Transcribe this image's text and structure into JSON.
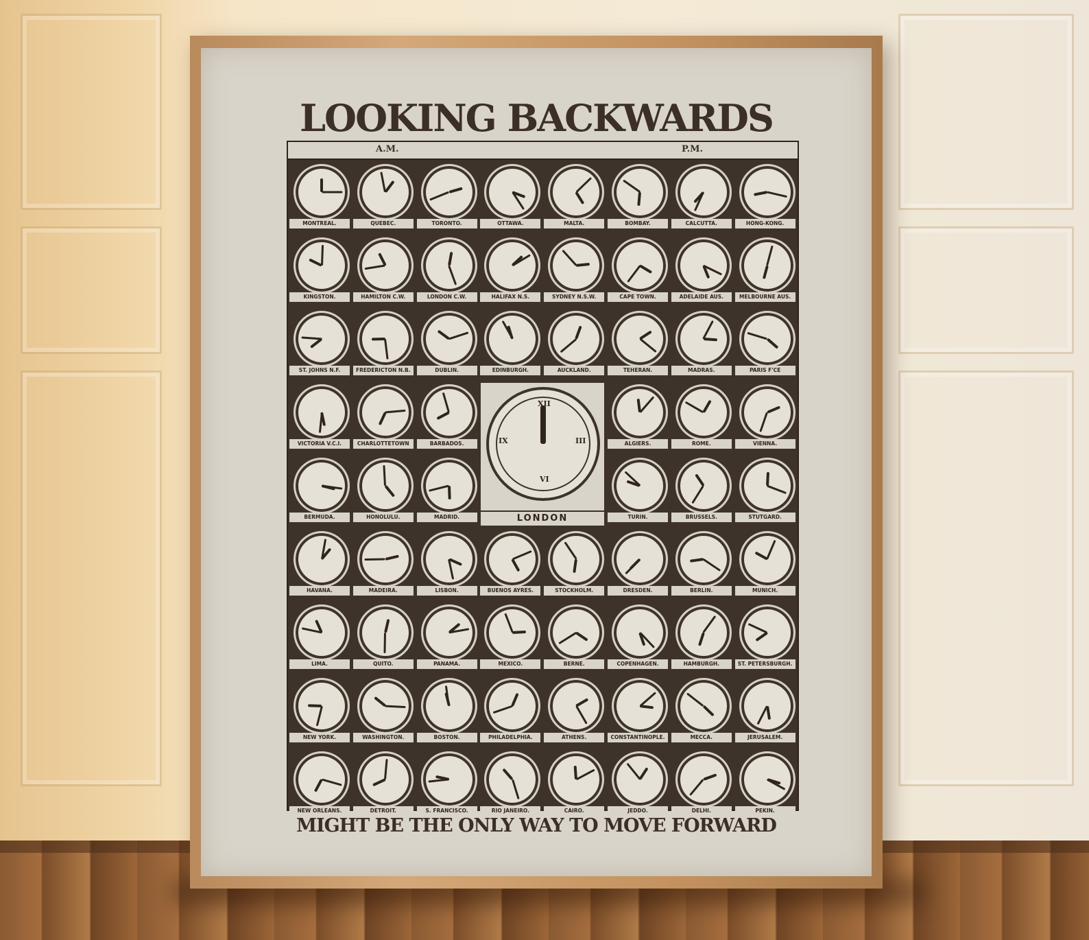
{
  "poster": {
    "title": "LOOKING BACKWARDS",
    "subtitle": "MIGHT BE THE ONLY WAY TO MOVE FORWARD",
    "am_label": "A.M.",
    "pm_label": "P.M.",
    "center_city": "LONDON"
  },
  "rows": [
    [
      "MONTREAL.",
      "QUEBEC.",
      "TORONTO.",
      "OTTAWA.",
      "MALTA.",
      "BOMBAY.",
      "CALCUTTA.",
      "HONG-KONG."
    ],
    [
      "KINGSTON.",
      "HAMILTON C.W.",
      "LONDON C.W.",
      "HALIFAX N.S.",
      "SYDNEY N.S.W.",
      "CAPE TOWN.",
      "ADELAIDE AUS.",
      "MELBOURNE AUS."
    ],
    [
      "ST. JOHNS N.F.",
      "FREDERICTON N.B.",
      "DUBLIN.",
      "EDINBURGH.",
      "AUCKLAND.",
      "TEHERAN.",
      "MADRAS.",
      "PARIS F'CE"
    ],
    [
      "VICTORIA V.C.I.",
      "CHARLOTTETOWN",
      "BARBADOS.",
      "",
      "",
      "ALGIERS.",
      "ROME.",
      "VIENNA."
    ],
    [
      "BERMUDA.",
      "HONOLULU.",
      "MADRID.",
      "",
      "",
      "TURIN.",
      "BRUSSELS.",
      "STUTGARD."
    ],
    [
      "HAVANA.",
      "MADEIRA.",
      "LISBON.",
      "BUENOS AYRES.",
      "STOCKHOLM.",
      "DRESDEN.",
      "BERLIN.",
      "MUNICH."
    ],
    [
      "LIMA.",
      "QUITO.",
      "PANAMA.",
      "MEXICO.",
      "BERNE.",
      "COPENHAGEN.",
      "HAMBURGH.",
      "ST. PETERSBURGH."
    ],
    [
      "NEW YORK.",
      "WASHINGTON.",
      "BOSTON.",
      "PHILADELPHIA.",
      "ATHENS.",
      "CONSTANTINOPLE.",
      "MECCA.",
      "JERUSALEM."
    ],
    [
      "NEW ORLEANS.",
      "DETROIT.",
      "S. FRANCISCO.",
      "RIO JANEIRO.",
      "CAIRO.",
      "JEDDO.",
      "DELHI.",
      "PEKIN."
    ]
  ],
  "colors": {
    "ink": "#3e332b",
    "paper": "#d9d4ca",
    "frame": "#c3925f"
  }
}
